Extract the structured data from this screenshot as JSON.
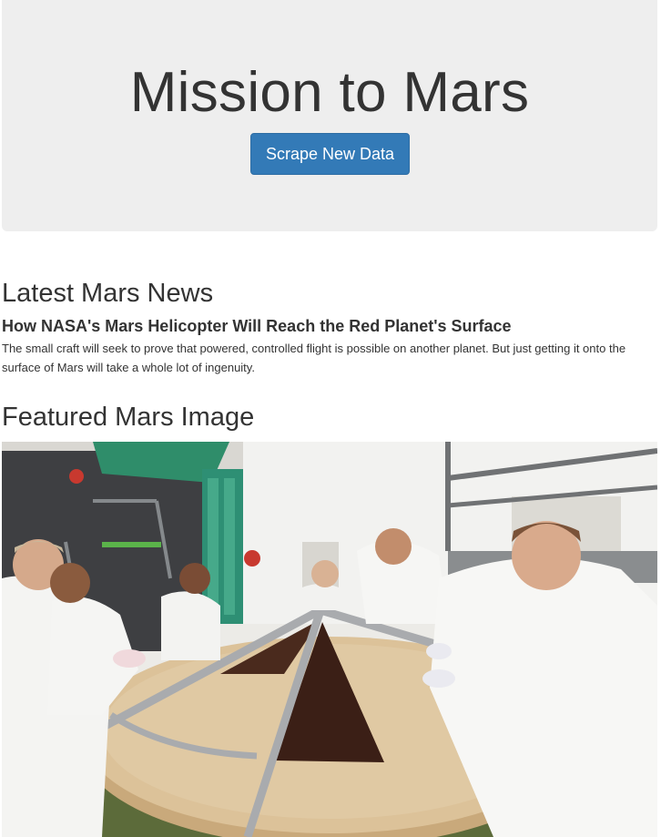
{
  "jumbotron": {
    "title": "Mission to Mars",
    "scrape_button_label": "Scrape New Data"
  },
  "news": {
    "section_title": "Latest Mars News",
    "headline": "How NASA's Mars Helicopter Will Reach the Red Planet's Surface",
    "teaser": "The small craft will seek to prove that powered, controlled flight is possible on another planet. But just getting it onto the surface of Mars will take a whole lot of ingenuity."
  },
  "featured_image": {
    "section_title": "Featured Mars Image"
  },
  "colors": {
    "jumbotron_bg": "#eeeeee",
    "button_bg": "#337ab7",
    "text": "#333333"
  }
}
